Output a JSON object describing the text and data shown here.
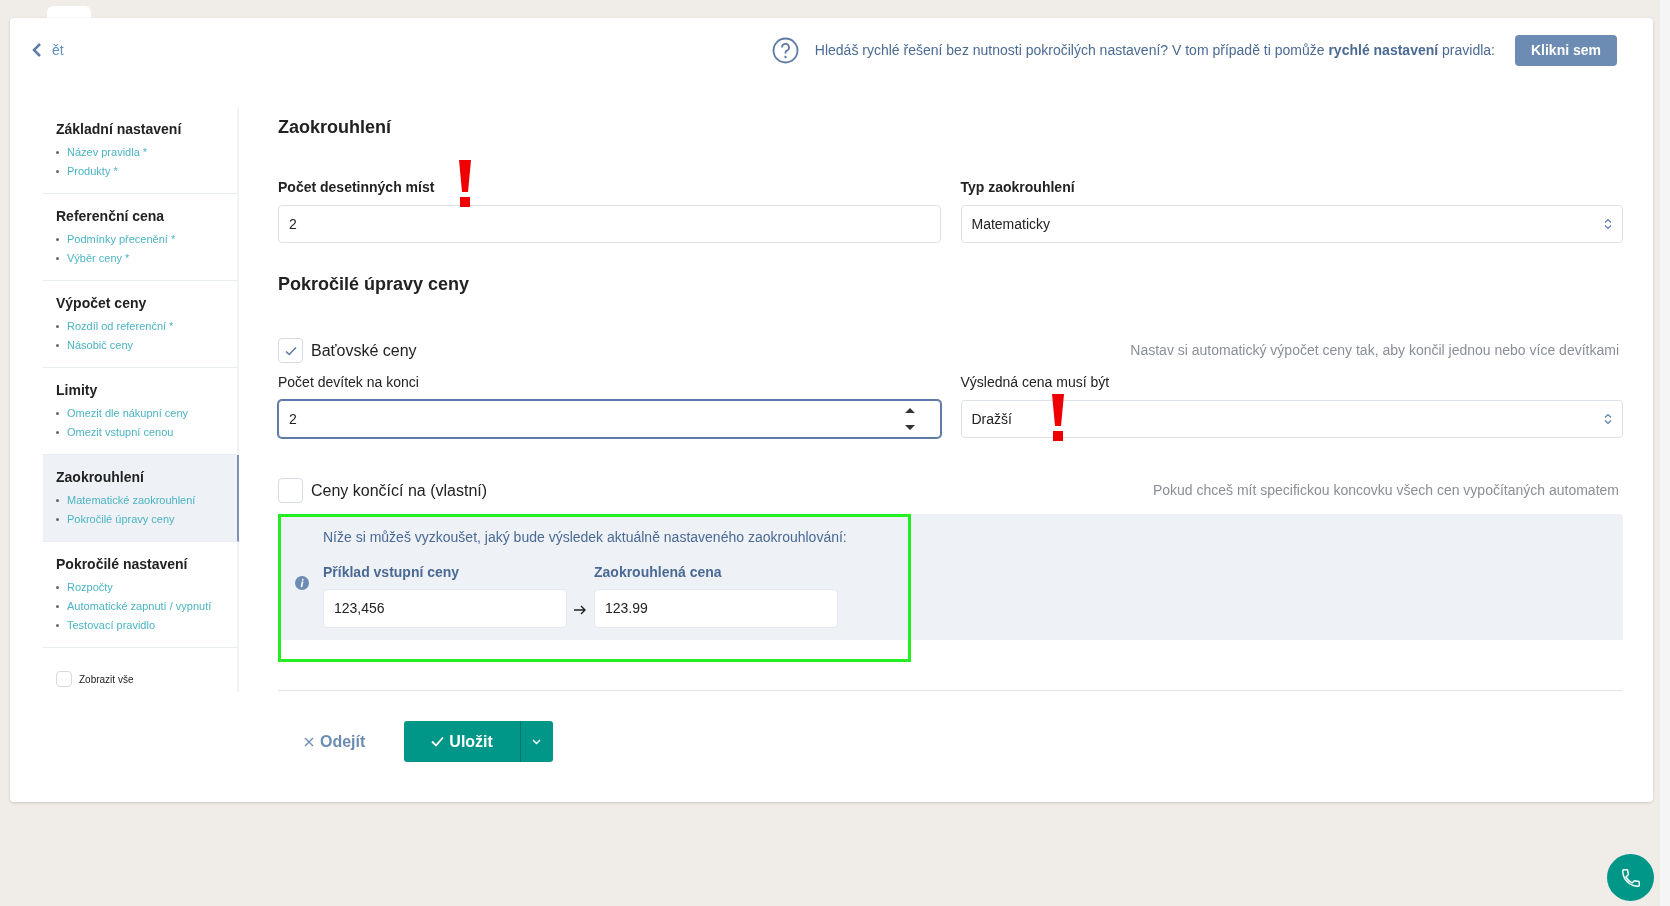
{
  "back_link": {
    "label": "ět"
  },
  "help_banner": {
    "text": "Hledáš rychlé řešení bez nutnosti pokročilých nastavení? V tom případě ti pomůže **rychlé nastavení** pravidla:",
    "button": "Klikni sem"
  },
  "sidebar": {
    "sections": [
      {
        "title": "Základní nastavení",
        "selected": false,
        "items": [
          "Název pravidla *",
          "Produkty *"
        ]
      },
      {
        "title": "Referenční cena",
        "selected": false,
        "items": [
          "Podmínky přecenění *",
          "Výběr ceny *"
        ]
      },
      {
        "title": "Výpočet ceny",
        "selected": false,
        "items": [
          "Rozdíl od referenční *",
          "Násobič ceny"
        ]
      },
      {
        "title": "Limity",
        "selected": false,
        "items": [
          "Omezit dle nákupní ceny",
          "Omezit vstupní cenou"
        ]
      },
      {
        "title": "Zaokrouhlení",
        "selected": true,
        "items": [
          "Matematické zaokrouhlení",
          "Pokročilé úpravy ceny"
        ]
      },
      {
        "title": "Pokročilé nastavení",
        "selected": false,
        "items": [
          "Rozpočty",
          "Automatické zapnutí / vypnutí",
          "Testovací pravidlo"
        ]
      }
    ],
    "show_all": {
      "label": "Zobrazit vše",
      "checked": false
    }
  },
  "section_title": "Zaokrouhlení",
  "rounding_fields": [
    {
      "kind": "number",
      "label": "Počet desetinných míst",
      "value": "2",
      "focused": false
    },
    {
      "kind": "select",
      "label": "Typ zaokrouhlení",
      "value": "Matematicky"
    }
  ],
  "advanced_title": "Pokročilé úpravy ceny",
  "bata_option": {
    "label": "Baťovské ceny",
    "checked": true,
    "hint": "Nastav si automatický výpočet ceny tak, aby končil jednou nebo více devítkami"
  },
  "nines_fields": [
    {
      "kind": "number",
      "label": "Počet devítek na konci",
      "value": "2",
      "focused": true
    },
    {
      "kind": "select",
      "label": "Výsledná cena musí být",
      "value": "Dražší"
    }
  ],
  "custom_option": {
    "label": "Ceny končící na (vlastní)",
    "checked": false,
    "hint": "Pokud chceš mít specifickou koncovku všech cen vypočítaných automatem"
  },
  "tester": {
    "intro": "Níže si můžeš vyzkoušet, jaký bude výsledek aktuálně nastaveného zaokrouhlování:",
    "input": {
      "label": "Příklad vstupní ceny",
      "value": "123,456"
    },
    "output": {
      "label": "Zaokrouhlená cena",
      "value": "123.99"
    }
  },
  "actions": {
    "cancel": "Odejít",
    "save": "Uložit"
  }
}
